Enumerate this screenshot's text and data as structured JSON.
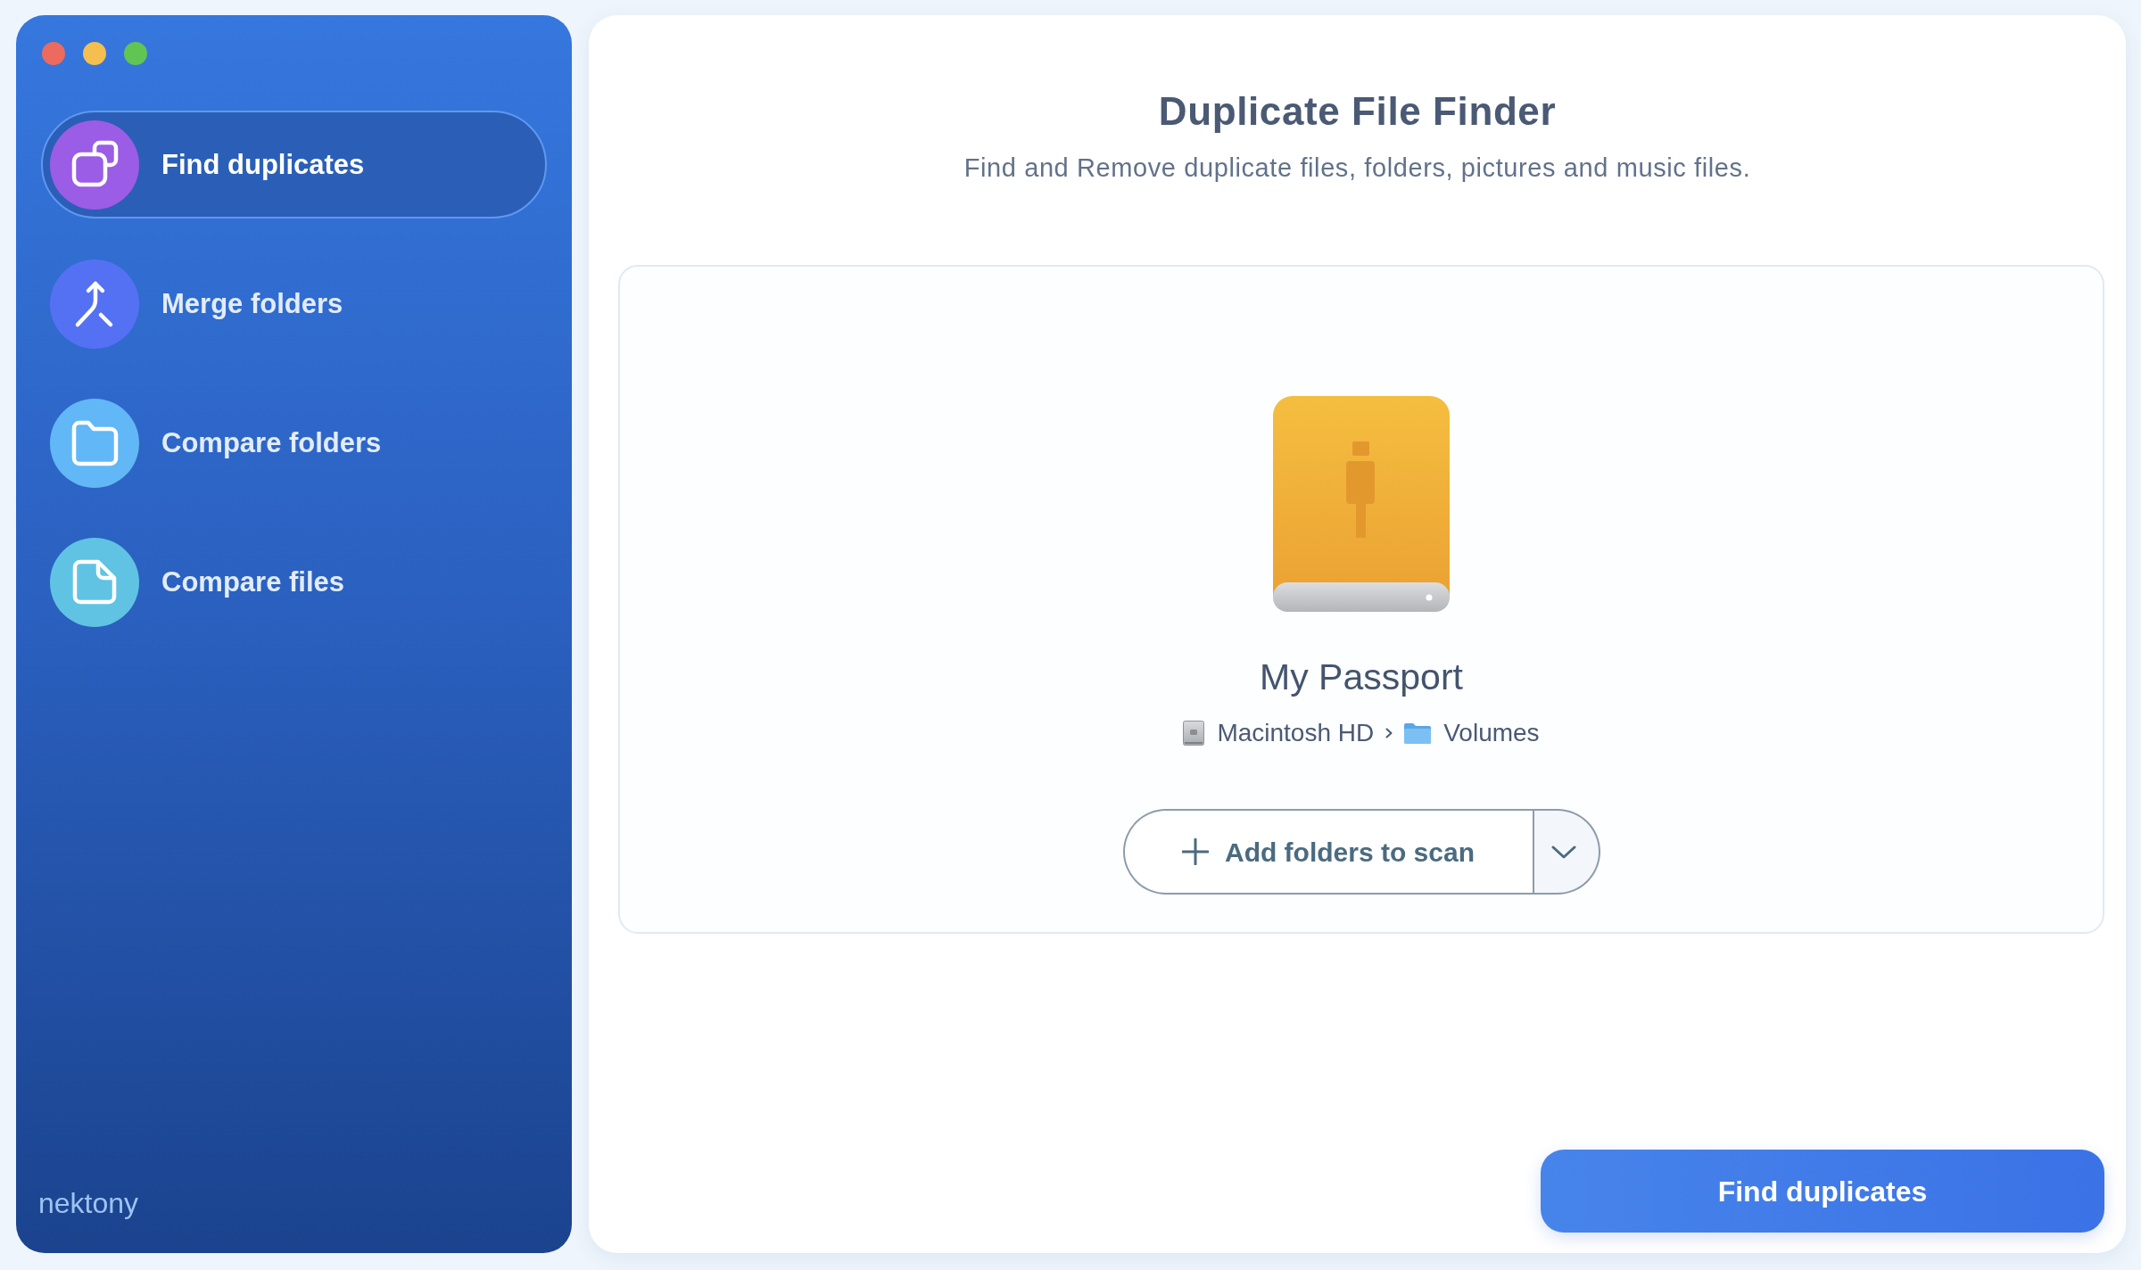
{
  "sidebar": {
    "items": [
      {
        "label": "Find duplicates",
        "kind": "duplicates",
        "color": "#9b5ce6",
        "selected": true
      },
      {
        "label": "Merge folders",
        "kind": "merge",
        "color": "#5571f3",
        "selected": false
      },
      {
        "label": "Compare folders",
        "kind": "folders",
        "color": "#62b7f7",
        "selected": false
      },
      {
        "label": "Compare files",
        "kind": "files",
        "color": "#60c3e3",
        "selected": false
      }
    ],
    "logo": "nektony"
  },
  "header": {
    "title": "Duplicate File Finder",
    "subtitle": "Find and Remove duplicate files, folders, pictures and music files."
  },
  "source": {
    "name": "My Passport",
    "path": [
      {
        "label": "Macintosh HD",
        "kind": "disk"
      },
      {
        "label": "Volumes",
        "kind": "folder"
      }
    ],
    "add_button": {
      "label": "Add folders to scan"
    }
  },
  "primary_button": {
    "label": "Find duplicates"
  }
}
